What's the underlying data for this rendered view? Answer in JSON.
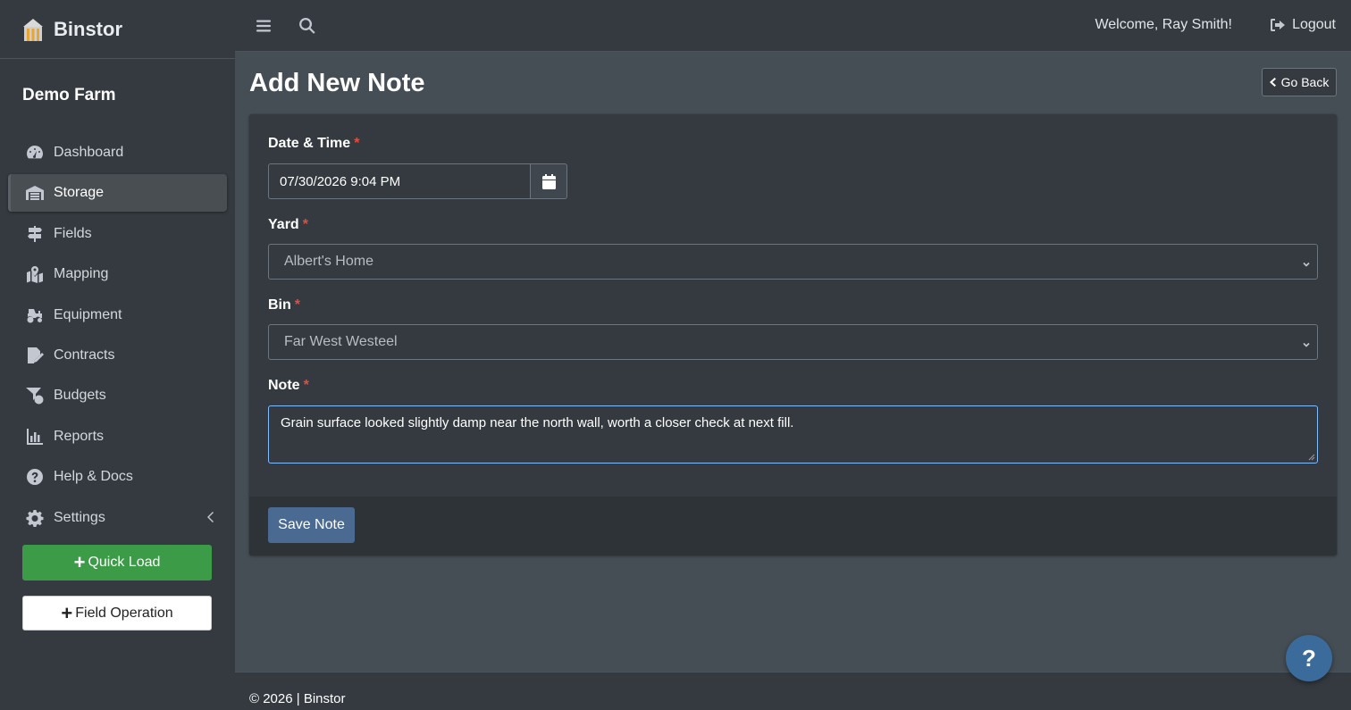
{
  "brand": {
    "name": "Binstor",
    "logo_icon": "silo-icon"
  },
  "sidebar": {
    "farm_name": "Demo Farm",
    "items": [
      {
        "label": "Dashboard",
        "icon": "tachometer-icon",
        "active": false
      },
      {
        "label": "Storage",
        "icon": "warehouse-icon",
        "active": true
      },
      {
        "label": "Fields",
        "icon": "signpost-icon",
        "active": false
      },
      {
        "label": "Mapping",
        "icon": "map-icon",
        "active": false
      },
      {
        "label": "Equipment",
        "icon": "tractor-icon",
        "active": false
      },
      {
        "label": "Contracts",
        "icon": "contract-icon",
        "active": false
      },
      {
        "label": "Budgets",
        "icon": "funnel-dollar-icon",
        "active": false
      },
      {
        "label": "Reports",
        "icon": "chart-bar-icon",
        "active": false
      },
      {
        "label": "Help & Docs",
        "icon": "question-circle-icon",
        "active": false
      },
      {
        "label": "Settings",
        "icon": "gear-icon",
        "active": false
      }
    ],
    "quick_load_label": "Quick Load",
    "field_operation_label": "Field Operation"
  },
  "topbar": {
    "welcome": "Welcome, Ray Smith!",
    "logout": "Logout"
  },
  "page": {
    "title": "Add New Note",
    "go_back": "Go Back"
  },
  "form": {
    "datetime_label": "Date & Time",
    "datetime_value": "07/30/2026 9:04 PM",
    "yard_label": "Yard",
    "yard_value": "Albert's Home",
    "bin_label": "Bin",
    "bin_value": "Far West Westeel",
    "note_label": "Note",
    "note_value": "Grain surface looked slightly damp near the north wall, worth a closer check at next fill.",
    "required_mark": "*",
    "save_label": "Save Note"
  },
  "footer": {
    "text": "© 2026 | Binstor"
  },
  "help_fab": {
    "label": "?"
  },
  "colors": {
    "primary": "#4a6a92",
    "success": "#3c9b46",
    "required": "#e74c3c",
    "focus": "#80bdff"
  }
}
